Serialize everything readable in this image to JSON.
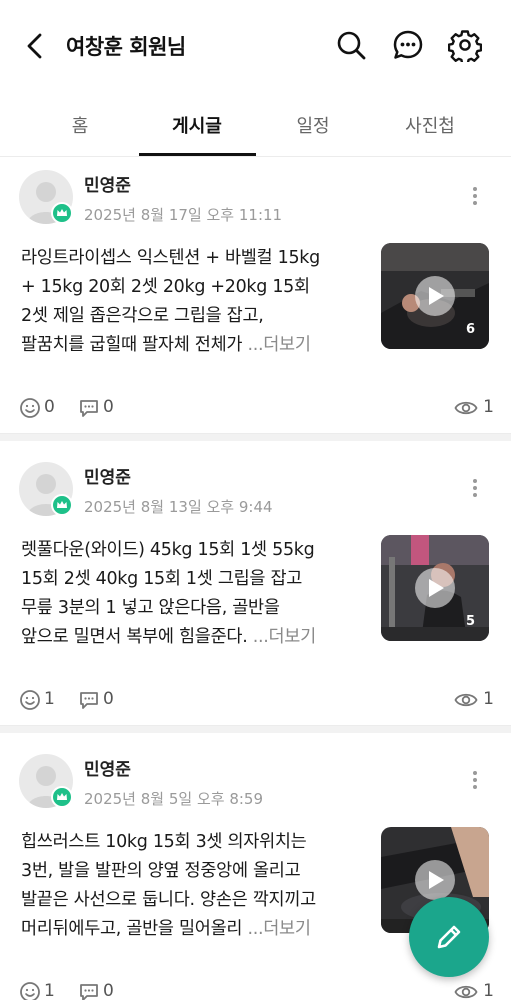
{
  "header": {
    "title": "여창훈 회원님"
  },
  "tabs": [
    {
      "label": "홈"
    },
    {
      "label": "게시글"
    },
    {
      "label": "일정"
    },
    {
      "label": "사진첩"
    }
  ],
  "posts": [
    {
      "author": "민영준",
      "date": "2025년 8월 17일 오후 11:11",
      "text": "라잉트라이셉스 익스텐션 + 바벨컬 15kg\n+ 15kg  20회 2셋 20kg   +20kg 15회\n2셋 제일 좁은각으로 그립을 잡고,\n팔꿈치를 굽힐때 팔자체 전체가 ",
      "read_more": "...더보기",
      "media_count": "6",
      "likes": "0",
      "comments": "0",
      "views": "1"
    },
    {
      "author": "민영준",
      "date": "2025년 8월 13일 오후 9:44",
      "text": "렛풀다운(와이드) 45kg 15회 1셋 55kg\n15회 2셋 40kg  15회 1셋 그립을 잡고\n무릎 3분의 1  넣고 앉은다음, 골반을\n앞으로 밀면서 복부에 힘을준다.  ",
      "read_more": "...더보기",
      "media_count": "5",
      "likes": "1",
      "comments": "0",
      "views": "1"
    },
    {
      "author": "민영준",
      "date": "2025년 8월 5일 오후 8:59",
      "text": "힙쓰러스트 10kg  15회 3셋 의자위치는\n3번, 발을 발판의 양옆 정중앙에 올리고\n발끝은 사선으로 둡니다. 양손은 깍지끼고\n머리뒤에두고, 골반을 밀어올리 ",
      "read_more": "...더보기",
      "media_count": "",
      "likes": "1",
      "comments": "0",
      "views": "1"
    }
  ],
  "colors": {
    "accent": "#1ba68c",
    "badge": "#1ec089"
  },
  "icons": [
    "back-arrow-icon",
    "search-icon",
    "chat-icon",
    "gear-icon",
    "more-vertical-icon",
    "smile-icon",
    "comment-icon",
    "eye-icon",
    "play-icon",
    "pencil-icon",
    "crown-icon"
  ]
}
